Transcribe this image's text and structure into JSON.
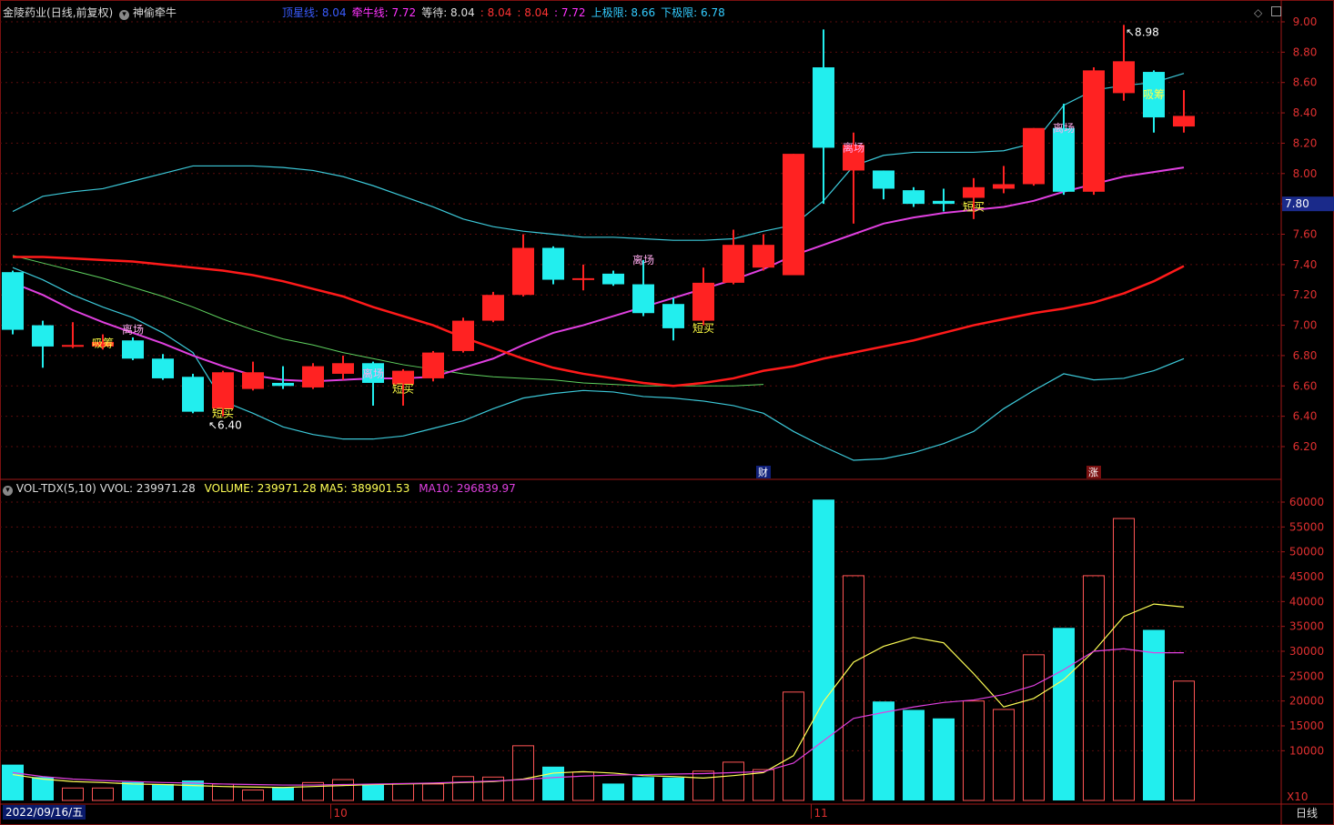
{
  "header": {
    "title": "金陵药业",
    "period_label": "(日线,前复权)",
    "indicator_name": "神偷牵牛",
    "readouts": [
      {
        "label": "顶星线:",
        "value": "8.04",
        "label_color": "#3a5cff",
        "value_color": "#3a5cff"
      },
      {
        "label": "牵牛线:",
        "value": "7.72",
        "label_color": "#ff33ff",
        "value_color": "#ff33ff"
      },
      {
        "label": "等待:",
        "value": "8.04",
        "label_color": "#dddddd",
        "value_color": "#dddddd"
      },
      {
        "label": ":",
        "value": "8.04",
        "label_color": "#ff3333",
        "value_color": "#ff3333"
      },
      {
        "label": ":",
        "value": "8.04",
        "label_color": "#ff3333",
        "value_color": "#ff3333"
      },
      {
        "label": ":",
        "value": "7.72",
        "label_color": "#ff33ff",
        "value_color": "#ff33ff"
      },
      {
        "label": "上极限:",
        "value": "8.66",
        "label_color": "#33ccff",
        "value_color": "#33ccff"
      },
      {
        "label": "下极限:",
        "value": "6.78",
        "label_color": "#33ccff",
        "value_color": "#33ccff"
      }
    ]
  },
  "volume_header": {
    "name": "VOL-TDX(5,10)",
    "vvol": "VVOL: 239971.28",
    "volume": "VOLUME: 239971.28",
    "ma5": "MA5: 389901.53",
    "ma10": "MA10: 296839.97"
  },
  "axis": {
    "price_ticks": [
      "9.00",
      "8.80",
      "8.60",
      "8.40",
      "8.20",
      "8.00",
      "7.80",
      "7.60",
      "7.40",
      "7.20",
      "7.00",
      "6.80",
      "6.60",
      "6.40",
      "6.20"
    ],
    "current_price": "7.80",
    "volume_ticks": [
      "60000",
      "55000",
      "50000",
      "45000",
      "40000",
      "35000",
      "30000",
      "25000",
      "20000",
      "15000",
      "10000"
    ],
    "volume_unit": "X10",
    "date_label": "2022/09/16/五",
    "month_labels": [
      "10",
      "11"
    ],
    "period_button": "日线"
  },
  "markers": {
    "high_label": "8.98",
    "low_label": "6.40",
    "fin_badge": "财",
    "rise_badge": "涨",
    "signal_labels": [
      "离场",
      "离场",
      "离场",
      "离场",
      "离场",
      "吸筹",
      "吸筹",
      "短买",
      "短买",
      "短买",
      "短买"
    ]
  },
  "colors": {
    "up": "#ff2222",
    "down": "#22eeee",
    "ma_red": "#ff1a1a",
    "ma_magenta": "#e040e0",
    "band": "#3cc8d8",
    "long_ma": "#5fd25f",
    "vol_ma5": "#ffff55",
    "vol_ma10": "#e040e0"
  },
  "chart_data": {
    "type": "candlestick",
    "price_axis": [
      6.1,
      9.05
    ],
    "volume_axis_x10": [
      0,
      63000
    ],
    "candles": [
      {
        "o": 7.35,
        "c": 6.97,
        "h": 7.36,
        "l": 6.94,
        "v": 7200
      },
      {
        "o": 7.0,
        "c": 6.86,
        "h": 7.03,
        "l": 6.72,
        "v": 4700
      },
      {
        "o": 6.86,
        "c": 6.87,
        "h": 7.02,
        "l": 6.85,
        "v": 2500
      },
      {
        "o": 6.86,
        "c": 6.89,
        "h": 6.94,
        "l": 6.84,
        "v": 2500
      },
      {
        "o": 6.9,
        "c": 6.78,
        "h": 6.92,
        "l": 6.77,
        "v": 3700
      },
      {
        "o": 6.78,
        "c": 6.65,
        "h": 6.81,
        "l": 6.64,
        "v": 3300
      },
      {
        "o": 6.66,
        "c": 6.43,
        "h": 6.68,
        "l": 6.42,
        "v": 4000
      },
      {
        "o": 6.45,
        "c": 6.69,
        "h": 6.7,
        "l": 6.4,
        "v": 3300
      },
      {
        "o": 6.58,
        "c": 6.69,
        "h": 6.76,
        "l": 6.57,
        "v": 2100
      },
      {
        "o": 6.62,
        "c": 6.6,
        "h": 6.73,
        "l": 6.58,
        "v": 2700
      },
      {
        "o": 6.59,
        "c": 6.73,
        "h": 6.75,
        "l": 6.58,
        "v": 3600
      },
      {
        "o": 6.68,
        "c": 6.75,
        "h": 6.8,
        "l": 6.64,
        "v": 4200
      },
      {
        "o": 6.75,
        "c": 6.62,
        "h": 6.76,
        "l": 6.47,
        "v": 3200
      },
      {
        "o": 6.61,
        "c": 6.7,
        "h": 6.71,
        "l": 6.47,
        "v": 3400
      },
      {
        "o": 6.65,
        "c": 6.82,
        "h": 6.83,
        "l": 6.63,
        "v": 3300
      },
      {
        "o": 6.83,
        "c": 7.03,
        "h": 7.05,
        "l": 6.82,
        "v": 4800
      },
      {
        "o": 7.03,
        "c": 7.2,
        "h": 7.22,
        "l": 7.02,
        "v": 4700
      },
      {
        "o": 7.2,
        "c": 7.51,
        "h": 7.6,
        "l": 7.19,
        "v": 11000
      },
      {
        "o": 7.51,
        "c": 7.3,
        "h": 7.52,
        "l": 7.27,
        "v": 6800
      },
      {
        "o": 7.3,
        "c": 7.31,
        "h": 7.4,
        "l": 7.23,
        "v": 5700
      },
      {
        "o": 7.34,
        "c": 7.27,
        "h": 7.36,
        "l": 7.26,
        "v": 3400
      },
      {
        "o": 7.27,
        "c": 7.08,
        "h": 7.43,
        "l": 7.06,
        "v": 4700
      },
      {
        "o": 7.14,
        "c": 6.98,
        "h": 7.18,
        "l": 6.9,
        "v": 4600
      },
      {
        "o": 7.03,
        "c": 7.28,
        "h": 7.38,
        "l": 7.0,
        "v": 5900
      },
      {
        "o": 7.28,
        "c": 7.53,
        "h": 7.63,
        "l": 7.27,
        "v": 7700
      },
      {
        "o": 7.38,
        "c": 7.53,
        "h": 7.6,
        "l": 7.36,
        "v": 6200
      },
      {
        "o": 7.33,
        "c": 8.13,
        "h": 8.13,
        "l": 7.33,
        "v": 21800
      },
      {
        "o": 8.7,
        "c": 8.17,
        "h": 8.95,
        "l": 7.8,
        "v": 60500
      },
      {
        "o": 8.02,
        "c": 8.19,
        "h": 8.27,
        "l": 7.67,
        "v": 45200
      },
      {
        "o": 8.02,
        "c": 7.9,
        "h": 8.02,
        "l": 7.83,
        "v": 19900
      },
      {
        "o": 7.89,
        "c": 7.8,
        "h": 7.91,
        "l": 7.78,
        "v": 18200
      },
      {
        "o": 7.82,
        "c": 7.8,
        "h": 7.9,
        "l": 7.75,
        "v": 16500
      },
      {
        "o": 7.84,
        "c": 7.91,
        "h": 7.97,
        "l": 7.7,
        "v": 20000
      },
      {
        "o": 7.9,
        "c": 7.93,
        "h": 8.05,
        "l": 7.87,
        "v": 18300
      },
      {
        "o": 7.93,
        "c": 8.3,
        "h": 8.3,
        "l": 7.92,
        "v": 29300
      },
      {
        "o": 8.3,
        "c": 7.88,
        "h": 8.46,
        "l": 7.86,
        "v": 34700
      },
      {
        "o": 7.88,
        "c": 8.68,
        "h": 8.7,
        "l": 7.86,
        "v": 45200
      },
      {
        "o": 8.53,
        "c": 8.74,
        "h": 8.98,
        "l": 8.48,
        "v": 56700
      },
      {
        "o": 8.67,
        "c": 8.37,
        "h": 8.68,
        "l": 8.27,
        "v": 34300
      },
      {
        "o": 8.31,
        "c": 8.38,
        "h": 8.55,
        "l": 8.27,
        "v": 24000
      }
    ],
    "ma_red": [
      7.45,
      7.45,
      7.44,
      7.43,
      7.42,
      7.4,
      7.38,
      7.36,
      7.33,
      7.29,
      7.24,
      7.19,
      7.12,
      7.06,
      7.0,
      6.92,
      6.85,
      6.78,
      6.72,
      6.68,
      6.65,
      6.62,
      6.6,
      6.62,
      6.65,
      6.7,
      6.73,
      6.78,
      6.82,
      6.86,
      6.9,
      6.95,
      7.0,
      7.04,
      7.08,
      7.11,
      7.15,
      7.21,
      7.29,
      7.39
    ],
    "ma_magenta": [
      7.28,
      7.2,
      7.1,
      7.02,
      6.95,
      6.88,
      6.8,
      6.73,
      6.67,
      6.64,
      6.63,
      6.64,
      6.65,
      6.65,
      6.66,
      6.72,
      6.78,
      6.87,
      6.95,
      7.0,
      7.06,
      7.12,
      7.18,
      7.24,
      7.3,
      7.37,
      7.46,
      7.53,
      7.6,
      7.67,
      7.71,
      7.74,
      7.76,
      7.78,
      7.82,
      7.88,
      7.93,
      7.98,
      8.01,
      8.04
    ],
    "band_upper": [
      7.75,
      7.85,
      7.88,
      7.9,
      7.95,
      8.0,
      8.05,
      8.05,
      8.05,
      8.04,
      8.02,
      7.98,
      7.92,
      7.85,
      7.78,
      7.7,
      7.65,
      7.62,
      7.6,
      7.58,
      7.58,
      7.57,
      7.56,
      7.56,
      7.57,
      7.62,
      7.66,
      7.82,
      8.05,
      8.12,
      8.14,
      8.14,
      8.14,
      8.15,
      8.2,
      8.45,
      8.55,
      8.58,
      8.6,
      8.66
    ],
    "band_lower": [
      7.38,
      7.3,
      7.2,
      7.12,
      7.05,
      6.95,
      6.82,
      6.5,
      6.42,
      6.33,
      6.28,
      6.25,
      6.25,
      6.27,
      6.32,
      6.37,
      6.45,
      6.52,
      6.55,
      6.57,
      6.56,
      6.53,
      6.52,
      6.5,
      6.47,
      6.42,
      6.3,
      6.2,
      6.11,
      6.12,
      6.16,
      6.22,
      6.3,
      6.45,
      6.57,
      6.68,
      6.64,
      6.65,
      6.7,
      6.78
    ],
    "long_ma": [
      7.46,
      7.41,
      7.36,
      7.31,
      7.25,
      7.19,
      7.12,
      7.04,
      6.97,
      6.91,
      6.87,
      6.82,
      6.78,
      6.74,
      6.71,
      6.68,
      6.66,
      6.65,
      6.64,
      6.62,
      6.61,
      6.6,
      6.6,
      6.6,
      6.6,
      6.61
    ],
    "vol_ma5": [
      5200,
      4300,
      3800,
      3600,
      3300,
      3200,
      3000,
      2800,
      2700,
      2600,
      2800,
      3000,
      3200,
      3300,
      3400,
      3600,
      3800,
      4300,
      5500,
      5800,
      5500,
      5000,
      4800,
      4500,
      5000,
      5600,
      9000,
      19900,
      27800,
      31000,
      32800,
      31700,
      25500,
      18800,
      20500,
      24300,
      30000,
      37000,
      39500,
      38900
    ],
    "vol_ma10": [
      5600,
      4800,
      4300,
      4000,
      3800,
      3600,
      3500,
      3300,
      3200,
      3100,
      3100,
      3200,
      3300,
      3400,
      3500,
      3700,
      3900,
      4200,
      4600,
      4900,
      5100,
      5200,
      5300,
      5400,
      5600,
      5800,
      7500,
      12000,
      16500,
      17700,
      18800,
      19700,
      20200,
      21300,
      23100,
      26300,
      30000,
      30500,
      29700,
      29700
    ],
    "signals": [
      {
        "i": 4,
        "text": "离场",
        "price": 6.97,
        "color": "#ffaaee"
      },
      {
        "i": 12,
        "text": "离场",
        "price": 6.68,
        "color": "#ffaaee"
      },
      {
        "i": 21,
        "text": "离场",
        "price": 7.43,
        "color": "#ffaaee"
      },
      {
        "i": 28,
        "text": "离场",
        "price": 8.17,
        "color": "#ffaaee"
      },
      {
        "i": 35,
        "text": "离场",
        "price": 8.3,
        "color": "#ffaaee"
      },
      {
        "i": 3,
        "text": "吸筹",
        "price": 6.88,
        "color": "#ffff44"
      },
      {
        "i": 38,
        "text": "吸筹",
        "price": 8.52,
        "color": "#ffff44"
      },
      {
        "i": 7,
        "text": "短买",
        "price": 6.42,
        "color": "#ffff44"
      },
      {
        "i": 13,
        "text": "短买",
        "price": 6.58,
        "color": "#ffff44"
      },
      {
        "i": 23,
        "text": "短买",
        "price": 6.98,
        "color": "#ffff44"
      },
      {
        "i": 32,
        "text": "短买",
        "price": 7.78,
        "color": "#ffff44"
      }
    ]
  }
}
